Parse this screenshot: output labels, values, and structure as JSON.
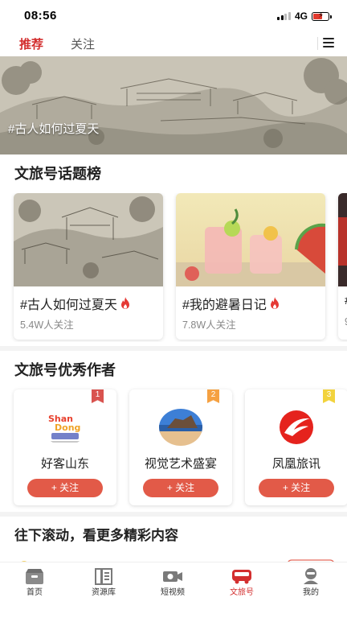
{
  "status_bar": {
    "time": "08:56",
    "network": "4G"
  },
  "top_tabs": [
    {
      "label": "推荐",
      "active": true
    },
    {
      "label": "关注",
      "active": false
    }
  ],
  "banner": {
    "caption": "#古人如何过夏天",
    "slides": 7,
    "active_slide": 0
  },
  "topics_section": {
    "title": "文旅号话题榜",
    "cards": [
      {
        "title": "#古人如何过夏天",
        "followers": "5.4W人关注",
        "image": "ancient-painting-image",
        "hot": true
      },
      {
        "title": "#我的避暑日记",
        "followers": "7.8W人关注",
        "image": "summer-drinks-image",
        "hot": true
      },
      {
        "title": "#",
        "followers": "9",
        "image": "city-night-image",
        "hot": false
      }
    ]
  },
  "authors_section": {
    "title": "文旅号优秀作者",
    "follow_label": "+ 关注",
    "cards": [
      {
        "name": "好客山东",
        "rank": "1",
        "rank_color": "#d9534f",
        "avatar": "shandong-logo"
      },
      {
        "name": "视觉艺术盛宴",
        "rank": "2",
        "rank_color": "#f5a142",
        "avatar": "beach-photo"
      },
      {
        "name": "凤凰旅讯",
        "rank": "3",
        "rank_color": "#f2d33d",
        "avatar": "phoenix-logo"
      }
    ]
  },
  "more_hint": "往下滚动，看更多精彩内容",
  "tab_bar": [
    {
      "label": "首页",
      "icon": "home-icon",
      "active": false
    },
    {
      "label": "资源库",
      "icon": "library-icon",
      "active": false
    },
    {
      "label": "短视频",
      "icon": "video-camera-icon",
      "active": false
    },
    {
      "label": "文旅号",
      "icon": "bus-icon",
      "active": true
    },
    {
      "label": "我的",
      "icon": "profile-icon",
      "active": false
    }
  ],
  "colors": {
    "accent": "#d32f2f",
    "follow_button": "#e25a48"
  }
}
